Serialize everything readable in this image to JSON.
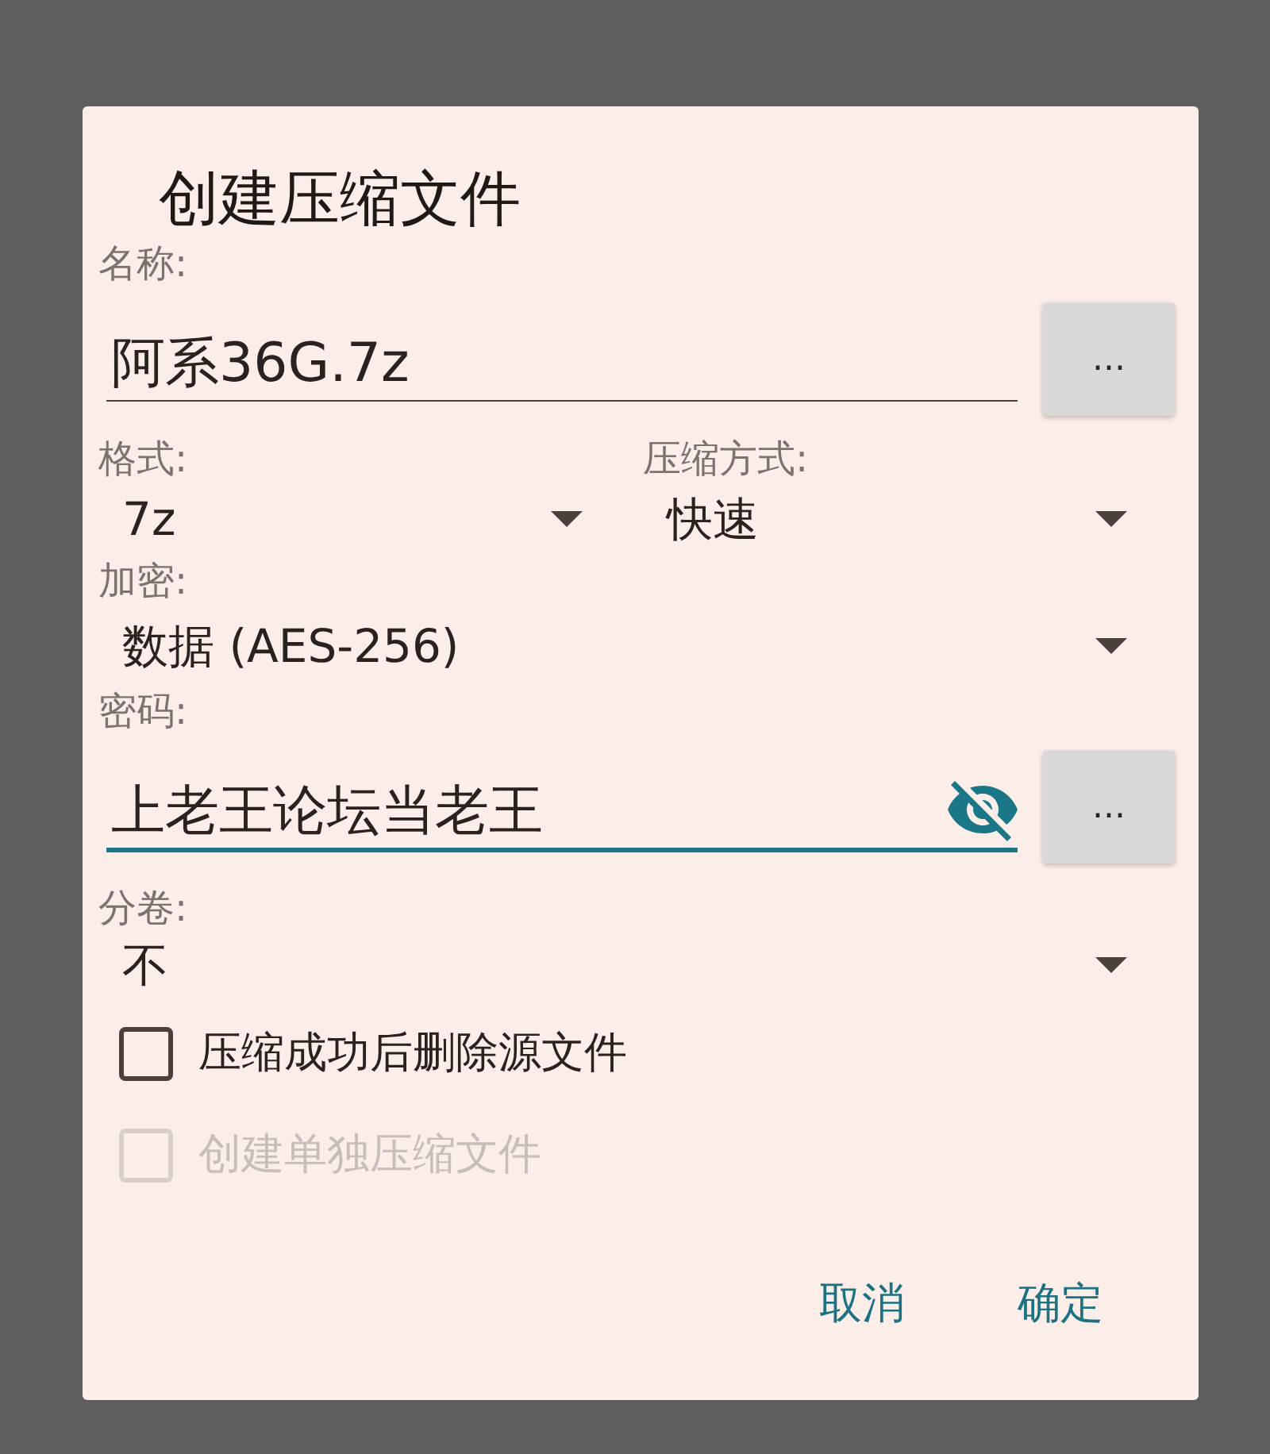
{
  "dialog": {
    "title": "创建压缩文件",
    "name": {
      "label": "名称:",
      "value": "阿系36G.7z",
      "focused": false,
      "button": "..."
    },
    "format": {
      "label": "格式:",
      "value": "7z"
    },
    "method": {
      "label": "压缩方式:",
      "value": "快速"
    },
    "encryption": {
      "label": "加密:",
      "value": "数据 (AES-256)"
    },
    "password": {
      "label": "密码:",
      "value": "上老王论坛当老王",
      "focused": true,
      "button": "..."
    },
    "split": {
      "label": "分卷:",
      "value": "不"
    },
    "checkboxes": [
      {
        "label": "压缩成功后删除源文件",
        "checked": false,
        "disabled": false
      },
      {
        "label": "创建单独压缩文件",
        "checked": false,
        "disabled": true
      }
    ],
    "buttons": [
      {
        "label": "取消"
      },
      {
        "label": "确定"
      }
    ]
  }
}
